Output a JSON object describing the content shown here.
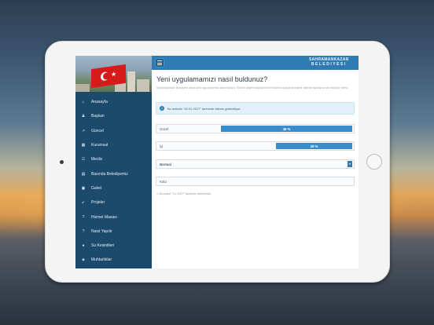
{
  "app": {
    "brand_line1": "SAHRAMANKAZAN",
    "brand_line2": "BELEDIYESI"
  },
  "sidebar": {
    "items": [
      {
        "label": "Anasayfa",
        "icon": "home-icon",
        "glyph": "⌂"
      },
      {
        "label": "Başkan",
        "icon": "user-icon",
        "glyph": "♟"
      },
      {
        "label": "Güncel",
        "icon": "trend-icon",
        "glyph": "↗"
      },
      {
        "label": "Kurumsal",
        "icon": "building-icon",
        "glyph": "▦"
      },
      {
        "label": "Meclis",
        "icon": "users-icon",
        "glyph": "☷"
      },
      {
        "label": "Basında Belediyemiz",
        "icon": "newspaper-icon",
        "glyph": "▤"
      },
      {
        "label": "Galeri",
        "icon": "image-icon",
        "glyph": "▣"
      },
      {
        "label": "Projeler",
        "icon": "rocket-icon",
        "glyph": "➹"
      },
      {
        "label": "Hizmet Masası",
        "icon": "help-icon",
        "glyph": "?"
      },
      {
        "label": "Nasıl Yapılır",
        "icon": "question-icon",
        "glyph": "?"
      },
      {
        "label": "Su Kesintileri",
        "icon": "water-drop-icon",
        "glyph": "●"
      },
      {
        "label": "Muhtarlıklar",
        "icon": "shield-icon",
        "glyph": "◈"
      }
    ]
  },
  "survey": {
    "title": "Yeni uygulamamızı nasıl buldunuz?",
    "description": "Sahramankazan Belediyesi olarak yeni uygulamamızla karşınızdayız. Sizlerin değerli düşüncelerinizi bizimle paylaşarak değerli vaktinizi ayırdığınız için teşekkür ederiz.",
    "info_text": "Bu anketin \"30.01.2017\" tarihinde bitimin gösteriliyor.",
    "options": [
      {
        "label": "Güzel",
        "percent_text": "46 %",
        "percent": 46,
        "type": "bar"
      },
      {
        "label": "İyi",
        "percent_text": "28 %",
        "percent": 28,
        "type": "bar"
      },
      {
        "label": "Normal",
        "type": "select",
        "selected": true
      },
      {
        "label": "Kötü",
        "type": "empty"
      }
    ],
    "footer": "Bu anket \"3.2.2017\" tarihinde eklenmiştir."
  },
  "colors": {
    "sidebar": "#1c4a6c",
    "topbar": "#2f7cb4",
    "bar": "#3b8ccb"
  }
}
